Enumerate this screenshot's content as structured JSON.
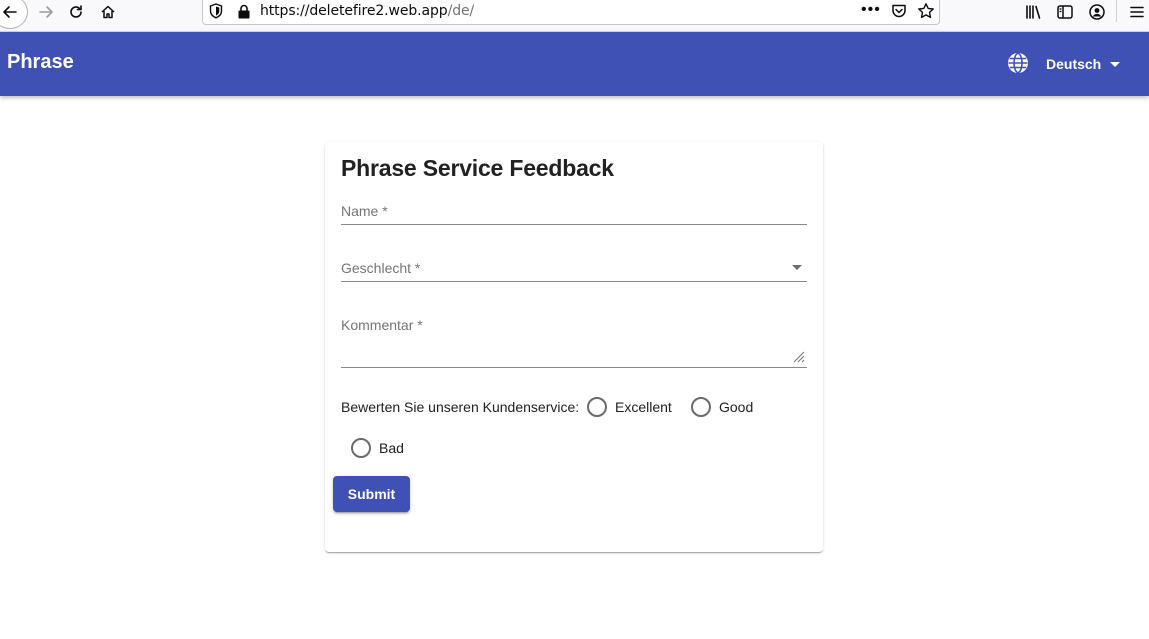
{
  "browser": {
    "url_host": "https://deletefire2.web.app",
    "url_path": "/de/",
    "page_actions": "•••"
  },
  "appbar": {
    "title": "Phrase",
    "language": "Deutsch",
    "color": "#3f51b5"
  },
  "form": {
    "title": "Phrase Service Feedback",
    "name_label": "Name *",
    "gender_label": "Geschlecht *",
    "comment_label": "Kommentar *",
    "rating_label": "Bewerten Sie unseren Kundenservice:",
    "rating_options": [
      {
        "label": "Excellent",
        "selected": false
      },
      {
        "label": "Good",
        "selected": false
      },
      {
        "label": "Bad",
        "selected": false
      }
    ],
    "submit_label": "Submit"
  },
  "icons": [
    "back-arrow-icon",
    "forward-arrow-icon",
    "reload-icon",
    "home-icon",
    "shield-icon",
    "lock-icon",
    "pocket-icon",
    "bookmark-star-icon",
    "library-icon",
    "sidebar-icon",
    "account-icon",
    "menu-icon",
    "globe-icon",
    "chevron-down-icon"
  ]
}
